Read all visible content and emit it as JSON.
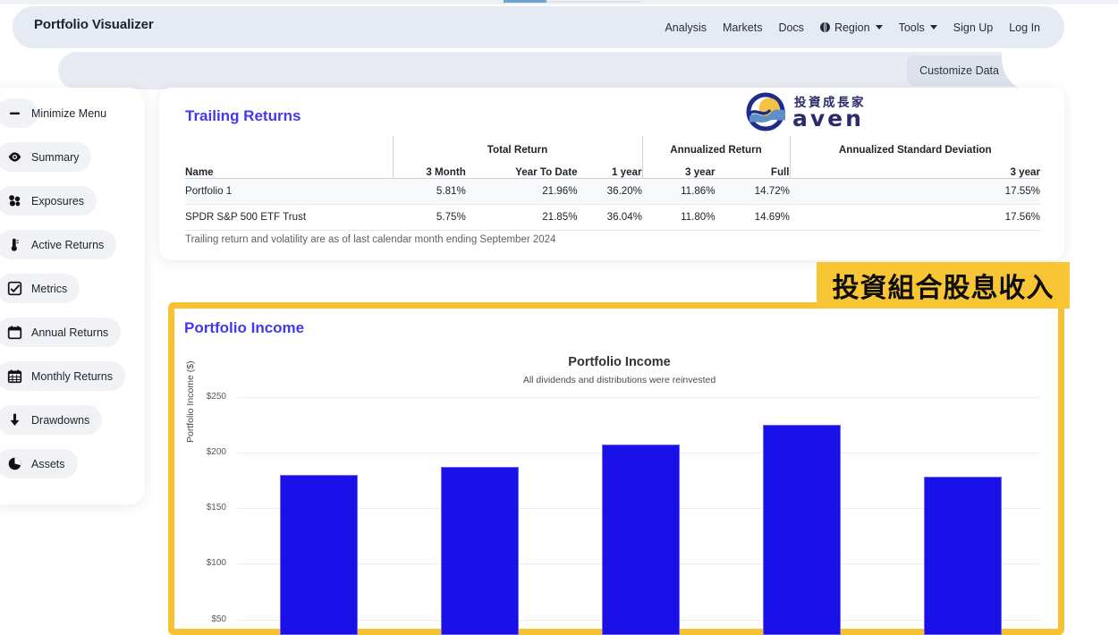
{
  "navbar": {
    "brand": "Portfolio Visualizer",
    "links": [
      {
        "label": "Analysis",
        "icon": ""
      },
      {
        "label": "Markets",
        "icon": ""
      },
      {
        "label": "Docs",
        "icon": ""
      },
      {
        "label": "Region",
        "icon": "globe-icon",
        "caret": true
      },
      {
        "label": "Tools",
        "icon": "",
        "caret": true
      },
      {
        "label": "Sign Up",
        "icon": ""
      },
      {
        "label": "Log In",
        "icon": ""
      }
    ]
  },
  "subbar": {
    "customize_data_label": "Customize Data"
  },
  "sidebar": {
    "items": [
      {
        "label": "Minimize Menu",
        "icon": "minus-icon"
      },
      {
        "label": "Summary",
        "icon": "eye-icon"
      },
      {
        "label": "Exposures",
        "icon": "cubes-icon"
      },
      {
        "label": "Active Returns",
        "icon": "thermometer-icon"
      },
      {
        "label": "Metrics",
        "icon": "checkbox-icon"
      },
      {
        "label": "Annual Returns",
        "icon": "calendar-icon"
      },
      {
        "label": "Monthly Returns",
        "icon": "calendar-grid-icon"
      },
      {
        "label": "Drawdowns",
        "icon": "arrow-down-icon"
      },
      {
        "label": "Assets",
        "icon": "pie-chart-icon"
      }
    ]
  },
  "logo": {
    "chinese": "投資成長家",
    "english": "aven"
  },
  "trailing_returns": {
    "title": "Trailing Returns",
    "group_headers": [
      "",
      "Total Return",
      "Annualized Return",
      "Annualized Standard Deviation"
    ],
    "columns": [
      "Name",
      "3 Month",
      "Year To Date",
      "1 year",
      "3 year",
      "Full",
      "3 year"
    ],
    "rows": [
      {
        "name": "Portfolio 1",
        "three_month": "5.81%",
        "ytd": "21.96%",
        "one_year": "36.20%",
        "three_year": "11.86%",
        "full": "14.72%",
        "std_three_year": "17.55%"
      },
      {
        "name": "SPDR S&P 500 ETF Trust",
        "three_month": "5.75%",
        "ytd": "21.85%",
        "one_year": "36.04%",
        "three_year": "11.80%",
        "full": "14.69%",
        "std_three_year": "17.56%"
      }
    ],
    "note": "Trailing return and volatility are as of last calendar month ending September 2024"
  },
  "annotation_banner": {
    "text": "投資組合股息收入",
    "background": "#F8C634"
  },
  "portfolio_income": {
    "card_title": "Portfolio Income"
  },
  "chart_data": {
    "type": "bar",
    "title": "Portfolio Income",
    "subtitle": "All dividends and distributions were reinvested",
    "xlabel": "",
    "ylabel": "Portfolio Income ($)",
    "categories": [
      "",
      "",
      "",
      "",
      ""
    ],
    "values": [
      180,
      187,
      207,
      225,
      178
    ],
    "ytick_labels": [
      "$250",
      "$200",
      "$150",
      "$100",
      "$50"
    ],
    "ytick_values": [
      250,
      200,
      150,
      100,
      50
    ],
    "ylim": [
      0,
      270
    ],
    "grid": true,
    "legend": "none",
    "bar_color": "#1A10E8"
  }
}
